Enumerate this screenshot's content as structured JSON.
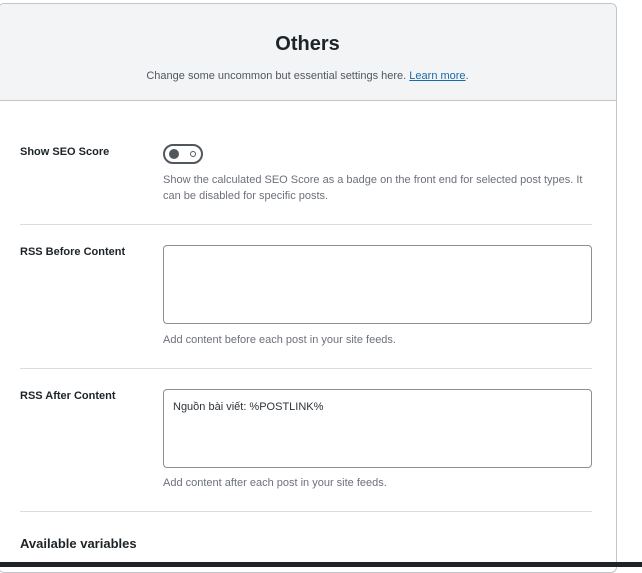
{
  "header": {
    "title": "Others",
    "description": "Change some uncommon but essential settings here.",
    "learn_more_link": "Learn more",
    "description_end": "."
  },
  "fields": {
    "seo_score": {
      "label": "Show SEO Score",
      "toggle_state": "off",
      "help": "Show the calculated SEO Score as a badge on the front end for selected post types. It can be disabled for specific posts."
    },
    "rss_before": {
      "label": "RSS Before Content",
      "value": "",
      "help": "Add content before each post in your site feeds."
    },
    "rss_after": {
      "label": "RSS After Content",
      "value": "Nguồn bài viết: %POSTLINK%",
      "help": "Add content after each post in your site feeds."
    }
  },
  "variables_section": {
    "heading": "Available variables"
  },
  "colors": {
    "header_bg": "#f3f4f5",
    "link": "#1a6aa8",
    "toggle": "#50575e"
  }
}
